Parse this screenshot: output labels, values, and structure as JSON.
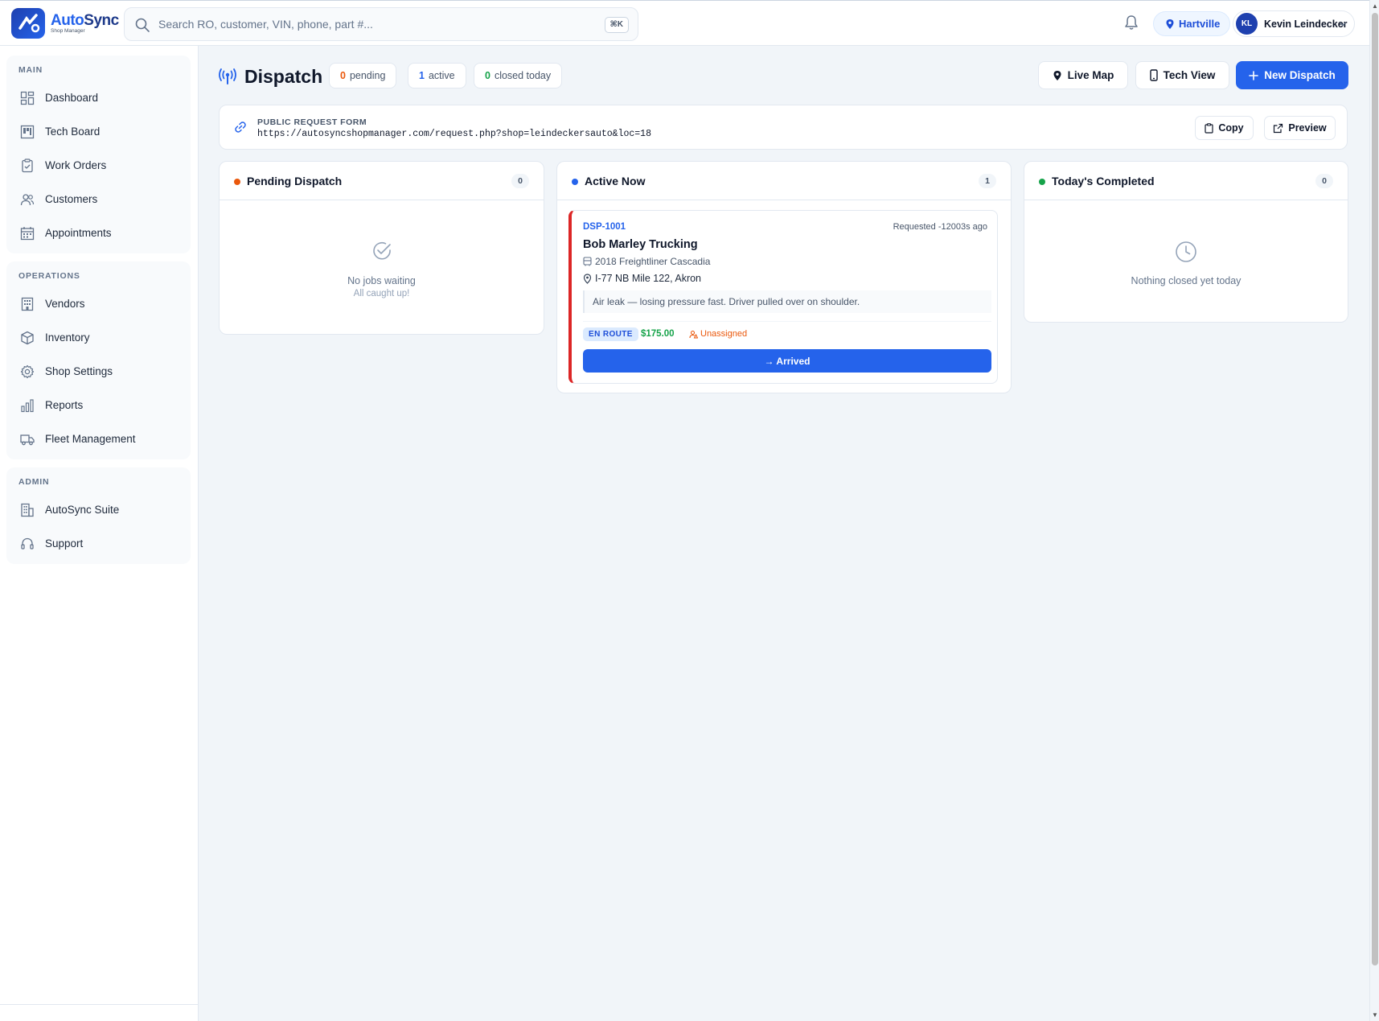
{
  "app": {
    "name_part1": "Auto",
    "name_part2": "Sync",
    "subtitle": "Shop Manager"
  },
  "search": {
    "placeholder": "Search RO, customer, VIN, phone, part #...",
    "shortcut": "⌘K"
  },
  "header": {
    "location": "Hartville",
    "user_initials": "KL",
    "user_name": "Kevin Leindecker"
  },
  "sidebar": {
    "groups": [
      {
        "title": "MAIN",
        "items": [
          {
            "label": "Dashboard",
            "icon": "dashboard-icon"
          },
          {
            "label": "Tech Board",
            "icon": "tech-board-icon"
          },
          {
            "label": "Work Orders",
            "icon": "clipboard-check-icon"
          },
          {
            "label": "Customers",
            "icon": "users-icon"
          },
          {
            "label": "Appointments",
            "icon": "calendar-icon"
          }
        ]
      },
      {
        "title": "OPERATIONS",
        "items": [
          {
            "label": "Vendors",
            "icon": "building-icon"
          },
          {
            "label": "Inventory",
            "icon": "box-icon"
          },
          {
            "label": "Shop Settings",
            "icon": "gear-icon"
          },
          {
            "label": "Reports",
            "icon": "bar-chart-icon"
          },
          {
            "label": "Fleet Management",
            "icon": "truck-icon"
          }
        ]
      },
      {
        "title": "ADMIN",
        "items": [
          {
            "label": "AutoSync Suite",
            "icon": "suite-icon"
          },
          {
            "label": "Support",
            "icon": "headset-icon"
          }
        ]
      }
    ]
  },
  "page": {
    "title": "Dispatch",
    "stats": [
      {
        "value": "0",
        "label": "pending",
        "color": "#ea580c"
      },
      {
        "value": "1",
        "label": "active",
        "color": "#2563eb"
      },
      {
        "value": "0",
        "label": "closed today",
        "color": "#16a34a"
      }
    ],
    "buttons": {
      "live_map": "Live Map",
      "tech_view": "Tech View",
      "new_dispatch": "New Dispatch"
    }
  },
  "request_form": {
    "label": "PUBLIC REQUEST FORM",
    "url": "https://autosyncshopmanager.com/request.php?shop=leindeckersauto&loc=18",
    "copy": "Copy",
    "preview": "Preview"
  },
  "columns": {
    "pending": {
      "title": "Pending Dispatch",
      "count": "0",
      "dot_color": "#ea580c",
      "empty_title": "No jobs waiting",
      "empty_sub": "All caught up!"
    },
    "active": {
      "title": "Active Now",
      "count": "1",
      "dot_color": "#2563eb"
    },
    "completed": {
      "title": "Today's Completed",
      "count": "0",
      "dot_color": "#16a34a",
      "empty_title": "Nothing closed yet today"
    }
  },
  "job": {
    "id": "DSP-1001",
    "requested": "Requested -12003s ago",
    "customer": "Bob Marley Trucking",
    "vehicle": "2018 Freightliner Cascadia",
    "location": "I-77 NB Mile 122, Akron",
    "note": "Air leak — losing pressure fast. Driver pulled over on shoulder.",
    "status": "EN ROUTE",
    "price": "$175.00",
    "assignee": "Unassigned",
    "action": "→ Arrived"
  },
  "colors": {
    "primary": "#2563eb",
    "urgent": "#dc2626",
    "success": "#16a34a",
    "warning": "#ea580c"
  }
}
